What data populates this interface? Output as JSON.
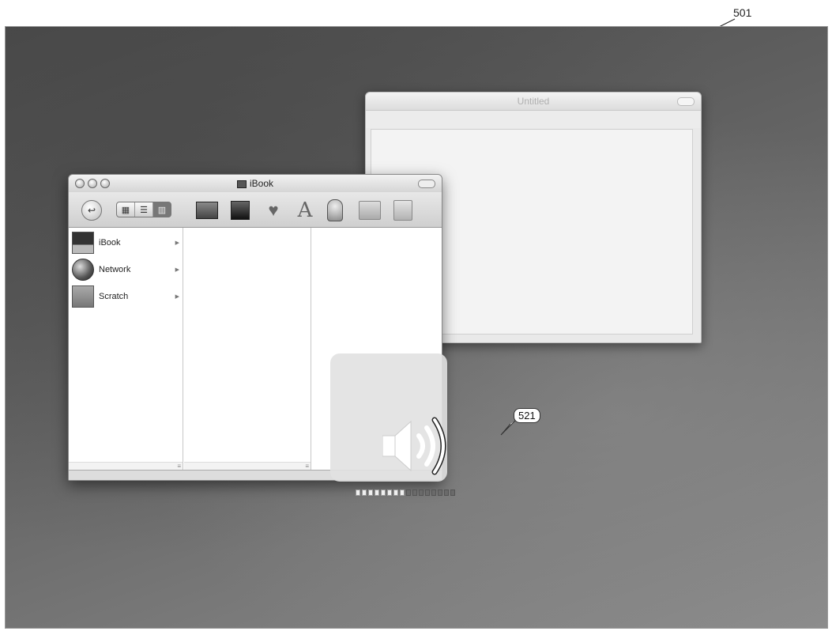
{
  "figure": {
    "ref_main": "501",
    "ref_overlay": "521"
  },
  "back_window": {
    "title": "Untitled"
  },
  "finder": {
    "title": "iBook",
    "sidebar": [
      {
        "label": "iBook",
        "icon": "ibook-drive-icon"
      },
      {
        "label": "Network",
        "icon": "network-globe-icon"
      },
      {
        "label": "Scratch",
        "icon": "scratch-disk-icon"
      }
    ],
    "toolbar": {
      "back_icon": "↩",
      "view_icons": [
        "▦",
        "☰",
        "▥"
      ]
    }
  },
  "volume_hud": {
    "icon": "speaker-volume-icon",
    "level_segments_on": 8,
    "level_segments_total": 16
  }
}
